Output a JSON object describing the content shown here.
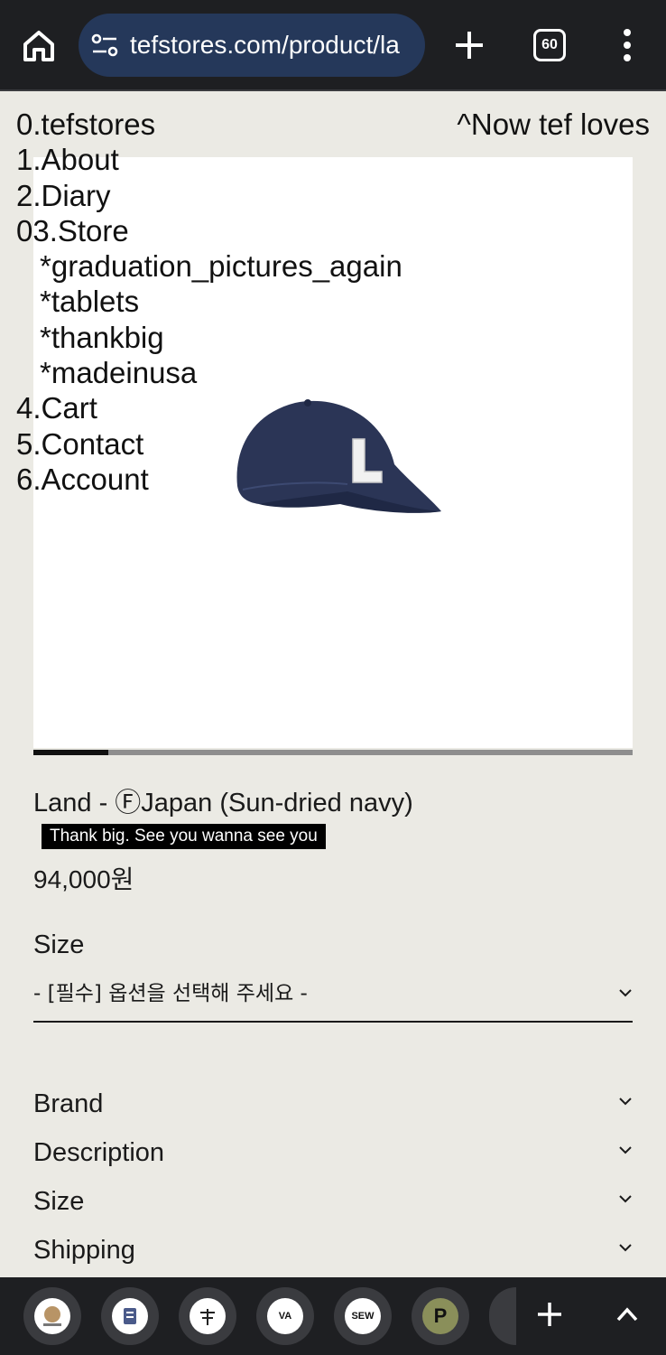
{
  "browser": {
    "url": "tefstores.com/product/la",
    "tab_count": "60",
    "icons": {
      "home": "home-icon",
      "site_settings": "tune-icon",
      "new_tab": "plus-icon",
      "tabs": "tab-switcher-icon",
      "menu": "more-vert-icon"
    }
  },
  "site_nav": {
    "items": [
      "0.tefstores",
      "1.About",
      "2.Diary",
      "03.Store",
      "*graduation_pictures_again",
      "*tablets",
      "*thankbig",
      "*madeinusa",
      "4.Cart",
      "5.Contact",
      "6.Account"
    ],
    "now_link": "^Now tef loves"
  },
  "product": {
    "image": "navy-cap-with-L-icon",
    "slider_progress": 0.125,
    "title": "Land - ⒻJapan (Sun-dried navy)",
    "tagline": "Thank big. See you wanna see you",
    "price": "94,000원",
    "size_label": "Size",
    "size_select_value": "- [필수] 옵션을 선택해 주세요 -"
  },
  "accordions": [
    "Brand",
    "Description",
    "Size",
    "Shipping"
  ],
  "bottom_tabs": {
    "items": [
      {
        "label": "",
        "icon": "site-favicon"
      },
      {
        "label": "",
        "icon": "site-favicon"
      },
      {
        "label": "",
        "icon": "site-favicon"
      },
      {
        "label": "VA",
        "icon": ""
      },
      {
        "label": "SEW",
        "icon": ""
      },
      {
        "label": "P",
        "icon": ""
      }
    ],
    "colors": {
      "bar": "#1e1f22",
      "circle": "#3a3b3f"
    }
  }
}
